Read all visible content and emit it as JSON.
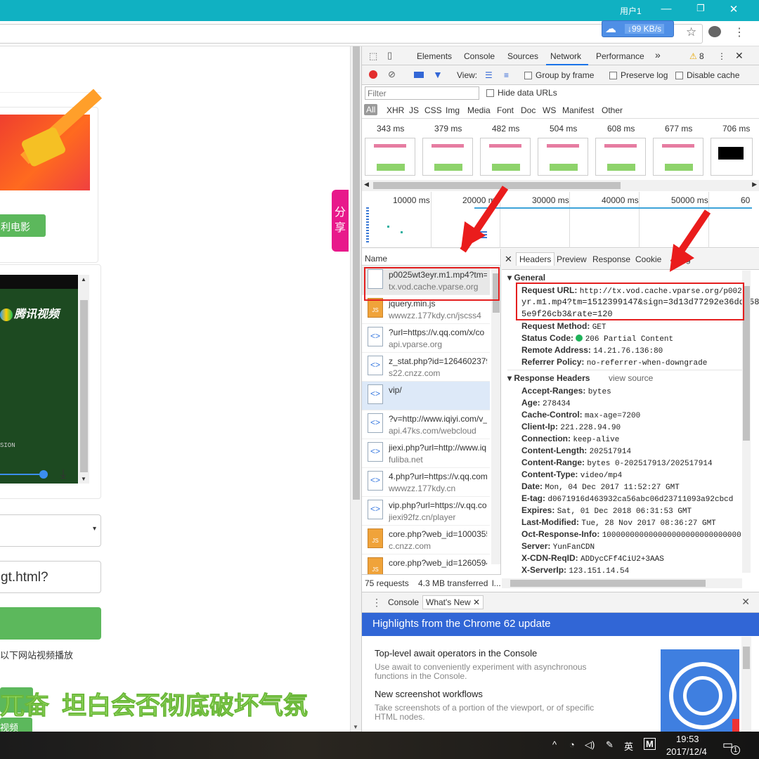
{
  "window": {
    "user_label": "用户1",
    "minimize": "—",
    "restore": "❐",
    "close": "✕"
  },
  "browser": {
    "download_speed": "↓99 KB/s",
    "star_icon": "☆",
    "menu_icon": "⋮"
  },
  "page": {
    "banner_button": "利电影",
    "video_logo": "腾讯视频",
    "video_caption": "SION",
    "select_arrow": "▾",
    "url_input_value": "gt.html?",
    "note_text": "以下网站视频播放",
    "overlay_text_a": "兀奋",
    "overlay_text_b": "坦白会否彻底破坏气氛",
    "small_green_text": "视频",
    "share_label": "分享"
  },
  "devtools": {
    "tabs": [
      "Elements",
      "Console",
      "Sources",
      "Network",
      "Performance"
    ],
    "active_tab": "Network",
    "more_tabs": "»",
    "warning_count": "8",
    "toolbar": {
      "view_label": "View:",
      "group_by_frame": "Group by frame",
      "preserve_log": "Preserve log",
      "disable_cache": "Disable cache"
    },
    "filter": {
      "placeholder": "Filter",
      "hide_data_urls": "Hide data URLs"
    },
    "type_filters": [
      "All",
      "XHR",
      "JS",
      "CSS",
      "Img",
      "Media",
      "Font",
      "Doc",
      "WS",
      "Manifest",
      "Other"
    ],
    "screenshot_times": [
      "343 ms",
      "379 ms",
      "482 ms",
      "504 ms",
      "608 ms",
      "677 ms",
      "706 ms"
    ],
    "timeline_ticks": [
      "10000 ms",
      "20000 ms",
      "30000 ms",
      "40000 ms",
      "50000 ms",
      "60"
    ],
    "name_header": "Name",
    "requests": [
      {
        "name": "p0025wt3eyr.m1.mp4?tm=",
        "domain": "tx.vod.cache.vparse.org",
        "type": "blank"
      },
      {
        "name": "jquery.min.js",
        "domain": "wwwzz.177kdy.cn/jscss4",
        "type": "js"
      },
      {
        "name": "?url=https://v.qq.com/x/co",
        "domain": "api.vparse.org",
        "type": "doc"
      },
      {
        "name": "z_stat.php?id=1264602379",
        "domain": "s22.cnzz.com",
        "type": "doc"
      },
      {
        "name": "vip/",
        "domain": "",
        "type": "doc"
      },
      {
        "name": "?v=http://www.iqiyi.com/v_",
        "domain": "api.47ks.com/webcloud",
        "type": "doc"
      },
      {
        "name": "jiexi.php?url=http://www.iq",
        "domain": "fuliba.net",
        "type": "doc"
      },
      {
        "name": "4.php?url=https://v.qq.com",
        "domain": "wwwzz.177kdy.cn",
        "type": "doc"
      },
      {
        "name": "vip.php?url=https://v.qq.co",
        "domain": "jiexi92fz.cn/player",
        "type": "doc"
      },
      {
        "name": "core.php?web_id=1000355",
        "domain": "c.cnzz.com",
        "type": "js"
      },
      {
        "name": "core.php?web_id=1260594",
        "domain": "",
        "type": "js"
      }
    ],
    "status_bar": {
      "requests": "75 requests",
      "transferred": "4.3 MB transferred",
      "more": "l..."
    },
    "detail_tabs": [
      "Headers",
      "Preview",
      "Response",
      "Cookies",
      "Timing"
    ],
    "detail_tab_visible": [
      "Headers",
      "Preview",
      "Response",
      "Cookie",
      "ning"
    ],
    "general": {
      "title": "General",
      "request_url_key": "Request URL:",
      "request_url_line1": "http://tx.vod.cache.vparse.org/p002",
      "request_url_line2": "yr.m1.mp4?tm=1512399147&sign=3d13d77292e36dd058",
      "request_url_line3": "5e9f26cb3&rate=120",
      "rows": [
        {
          "k": "Request Method:",
          "v": "GET"
        },
        {
          "k": "Status Code:",
          "v": "206 Partial Content"
        },
        {
          "k": "Remote Address:",
          "v": "14.21.76.136:80"
        },
        {
          "k": "Referrer Policy:",
          "v": "no-referrer-when-downgrade"
        }
      ]
    },
    "response_headers": {
      "title": "Response Headers",
      "view_source": "view source",
      "rows": [
        {
          "k": "Accept-Ranges:",
          "v": "bytes"
        },
        {
          "k": "Age:",
          "v": "278434"
        },
        {
          "k": "Cache-Control:",
          "v": "max-age=7200"
        },
        {
          "k": "Client-Ip:",
          "v": "221.228.94.90"
        },
        {
          "k": "Connection:",
          "v": "keep-alive"
        },
        {
          "k": "Content-Length:",
          "v": "202517914"
        },
        {
          "k": "Content-Range:",
          "v": "bytes 0-202517913/202517914"
        },
        {
          "k": "Content-Type:",
          "v": "video/mp4"
        },
        {
          "k": "Date:",
          "v": "Mon, 04 Dec 2017 11:52:27 GMT"
        },
        {
          "k": "E-tag:",
          "v": "d0671916d463932ca56abc06d23711093a92cbcd"
        },
        {
          "k": "Expires:",
          "v": "Sat, 01 Dec 2018 06:31:53 GMT"
        },
        {
          "k": "Last-Modified:",
          "v": "Tue, 28 Nov 2017 08:36:27 GMT"
        },
        {
          "k": "Oct-Response-Info:",
          "v": "100000000000000000000000000000"
        },
        {
          "k": "Server:",
          "v": "YunFanCDN"
        },
        {
          "k": "X-CDN-ReqID:",
          "v": "ADDycCFf4CiU2+3AAS"
        },
        {
          "k": "X-ServerIp:",
          "v": "123.151.14.54"
        }
      ]
    },
    "drawer": {
      "tabs": [
        "Console",
        "What's New"
      ],
      "highlights": "Highlights from the Chrome 62 update",
      "items": [
        {
          "title": "Top-level await operators in the Console",
          "desc": "Use await to conveniently experiment with asynchronous functions in the Console."
        },
        {
          "title": "New screenshot workflows",
          "desc": "Take screenshots of a portion of the viewport, or of specific HTML nodes."
        }
      ]
    }
  },
  "taskbar": {
    "ime": "英",
    "time": "19:53",
    "date": "2017/12/4",
    "notif_count": "1"
  },
  "colors": {
    "accent": "#10b1c2",
    "devtools_blue": "#1a73e8",
    "highlight_red": "#e41e1e",
    "brand_green": "#5cb85c"
  }
}
